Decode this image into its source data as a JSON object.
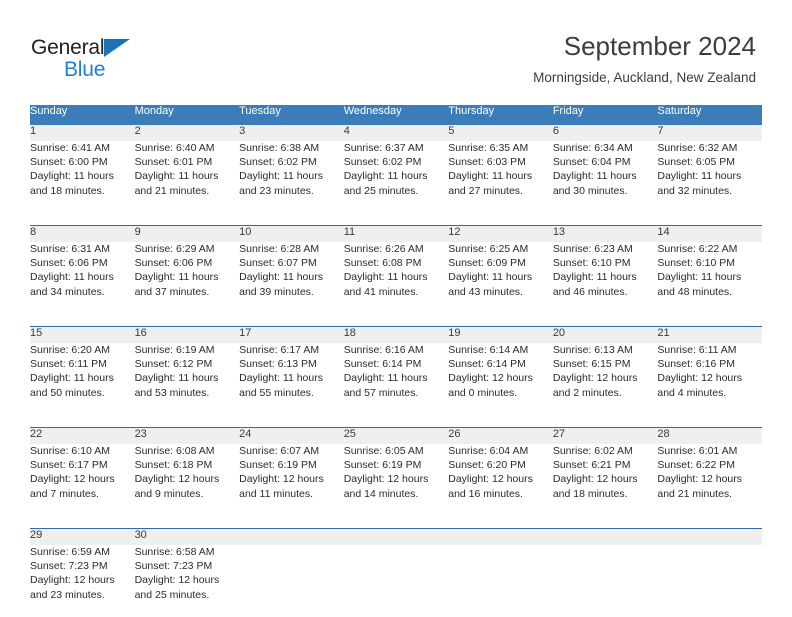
{
  "brand": {
    "line1": "General",
    "line2": "Blue",
    "triangle_color": "#1b72b8",
    "line1_color": "#231f20",
    "line2_color": "#1b83d4"
  },
  "header": {
    "title": "September 2024",
    "subtitle": "Morningside, Auckland, New Zealand"
  },
  "colors": {
    "header_blue": "#3b7cb9",
    "row_separator_blue": "#2f6ea8",
    "daynum_band": "#efeff0",
    "text": "#2b2b2b"
  },
  "weekday_headers": [
    "Sunday",
    "Monday",
    "Tuesday",
    "Wednesday",
    "Thursday",
    "Friday",
    "Saturday"
  ],
  "weeks": [
    [
      {
        "day": "1",
        "sunrise": "Sunrise: 6:41 AM",
        "sunset": "Sunset: 6:00 PM",
        "daylight1": "Daylight: 11 hours",
        "daylight2": "and 18 minutes."
      },
      {
        "day": "2",
        "sunrise": "Sunrise: 6:40 AM",
        "sunset": "Sunset: 6:01 PM",
        "daylight1": "Daylight: 11 hours",
        "daylight2": "and 21 minutes."
      },
      {
        "day": "3",
        "sunrise": "Sunrise: 6:38 AM",
        "sunset": "Sunset: 6:02 PM",
        "daylight1": "Daylight: 11 hours",
        "daylight2": "and 23 minutes."
      },
      {
        "day": "4",
        "sunrise": "Sunrise: 6:37 AM",
        "sunset": "Sunset: 6:02 PM",
        "daylight1": "Daylight: 11 hours",
        "daylight2": "and 25 minutes."
      },
      {
        "day": "5",
        "sunrise": "Sunrise: 6:35 AM",
        "sunset": "Sunset: 6:03 PM",
        "daylight1": "Daylight: 11 hours",
        "daylight2": "and 27 minutes."
      },
      {
        "day": "6",
        "sunrise": "Sunrise: 6:34 AM",
        "sunset": "Sunset: 6:04 PM",
        "daylight1": "Daylight: 11 hours",
        "daylight2": "and 30 minutes."
      },
      {
        "day": "7",
        "sunrise": "Sunrise: 6:32 AM",
        "sunset": "Sunset: 6:05 PM",
        "daylight1": "Daylight: 11 hours",
        "daylight2": "and 32 minutes."
      }
    ],
    [
      {
        "day": "8",
        "sunrise": "Sunrise: 6:31 AM",
        "sunset": "Sunset: 6:06 PM",
        "daylight1": "Daylight: 11 hours",
        "daylight2": "and 34 minutes."
      },
      {
        "day": "9",
        "sunrise": "Sunrise: 6:29 AM",
        "sunset": "Sunset: 6:06 PM",
        "daylight1": "Daylight: 11 hours",
        "daylight2": "and 37 minutes."
      },
      {
        "day": "10",
        "sunrise": "Sunrise: 6:28 AM",
        "sunset": "Sunset: 6:07 PM",
        "daylight1": "Daylight: 11 hours",
        "daylight2": "and 39 minutes."
      },
      {
        "day": "11",
        "sunrise": "Sunrise: 6:26 AM",
        "sunset": "Sunset: 6:08 PM",
        "daylight1": "Daylight: 11 hours",
        "daylight2": "and 41 minutes."
      },
      {
        "day": "12",
        "sunrise": "Sunrise: 6:25 AM",
        "sunset": "Sunset: 6:09 PM",
        "daylight1": "Daylight: 11 hours",
        "daylight2": "and 43 minutes."
      },
      {
        "day": "13",
        "sunrise": "Sunrise: 6:23 AM",
        "sunset": "Sunset: 6:10 PM",
        "daylight1": "Daylight: 11 hours",
        "daylight2": "and 46 minutes."
      },
      {
        "day": "14",
        "sunrise": "Sunrise: 6:22 AM",
        "sunset": "Sunset: 6:10 PM",
        "daylight1": "Daylight: 11 hours",
        "daylight2": "and 48 minutes."
      }
    ],
    [
      {
        "day": "15",
        "sunrise": "Sunrise: 6:20 AM",
        "sunset": "Sunset: 6:11 PM",
        "daylight1": "Daylight: 11 hours",
        "daylight2": "and 50 minutes."
      },
      {
        "day": "16",
        "sunrise": "Sunrise: 6:19 AM",
        "sunset": "Sunset: 6:12 PM",
        "daylight1": "Daylight: 11 hours",
        "daylight2": "and 53 minutes."
      },
      {
        "day": "17",
        "sunrise": "Sunrise: 6:17 AM",
        "sunset": "Sunset: 6:13 PM",
        "daylight1": "Daylight: 11 hours",
        "daylight2": "and 55 minutes."
      },
      {
        "day": "18",
        "sunrise": "Sunrise: 6:16 AM",
        "sunset": "Sunset: 6:14 PM",
        "daylight1": "Daylight: 11 hours",
        "daylight2": "and 57 minutes."
      },
      {
        "day": "19",
        "sunrise": "Sunrise: 6:14 AM",
        "sunset": "Sunset: 6:14 PM",
        "daylight1": "Daylight: 12 hours",
        "daylight2": "and 0 minutes."
      },
      {
        "day": "20",
        "sunrise": "Sunrise: 6:13 AM",
        "sunset": "Sunset: 6:15 PM",
        "daylight1": "Daylight: 12 hours",
        "daylight2": "and 2 minutes."
      },
      {
        "day": "21",
        "sunrise": "Sunrise: 6:11 AM",
        "sunset": "Sunset: 6:16 PM",
        "daylight1": "Daylight: 12 hours",
        "daylight2": "and 4 minutes."
      }
    ],
    [
      {
        "day": "22",
        "sunrise": "Sunrise: 6:10 AM",
        "sunset": "Sunset: 6:17 PM",
        "daylight1": "Daylight: 12 hours",
        "daylight2": "and 7 minutes."
      },
      {
        "day": "23",
        "sunrise": "Sunrise: 6:08 AM",
        "sunset": "Sunset: 6:18 PM",
        "daylight1": "Daylight: 12 hours",
        "daylight2": "and 9 minutes."
      },
      {
        "day": "24",
        "sunrise": "Sunrise: 6:07 AM",
        "sunset": "Sunset: 6:19 PM",
        "daylight1": "Daylight: 12 hours",
        "daylight2": "and 11 minutes."
      },
      {
        "day": "25",
        "sunrise": "Sunrise: 6:05 AM",
        "sunset": "Sunset: 6:19 PM",
        "daylight1": "Daylight: 12 hours",
        "daylight2": "and 14 minutes."
      },
      {
        "day": "26",
        "sunrise": "Sunrise: 6:04 AM",
        "sunset": "Sunset: 6:20 PM",
        "daylight1": "Daylight: 12 hours",
        "daylight2": "and 16 minutes."
      },
      {
        "day": "27",
        "sunrise": "Sunrise: 6:02 AM",
        "sunset": "Sunset: 6:21 PM",
        "daylight1": "Daylight: 12 hours",
        "daylight2": "and 18 minutes."
      },
      {
        "day": "28",
        "sunrise": "Sunrise: 6:01 AM",
        "sunset": "Sunset: 6:22 PM",
        "daylight1": "Daylight: 12 hours",
        "daylight2": "and 21 minutes."
      }
    ],
    [
      {
        "day": "29",
        "sunrise": "Sunrise: 6:59 AM",
        "sunset": "Sunset: 7:23 PM",
        "daylight1": "Daylight: 12 hours",
        "daylight2": "and 23 minutes."
      },
      {
        "day": "30",
        "sunrise": "Sunrise: 6:58 AM",
        "sunset": "Sunset: 7:23 PM",
        "daylight1": "Daylight: 12 hours",
        "daylight2": "and 25 minutes."
      },
      {
        "day": "",
        "sunrise": "",
        "sunset": "",
        "daylight1": "",
        "daylight2": ""
      },
      {
        "day": "",
        "sunrise": "",
        "sunset": "",
        "daylight1": "",
        "daylight2": ""
      },
      {
        "day": "",
        "sunrise": "",
        "sunset": "",
        "daylight1": "",
        "daylight2": ""
      },
      {
        "day": "",
        "sunrise": "",
        "sunset": "",
        "daylight1": "",
        "daylight2": ""
      },
      {
        "day": "",
        "sunrise": "",
        "sunset": "",
        "daylight1": "",
        "daylight2": ""
      }
    ]
  ]
}
